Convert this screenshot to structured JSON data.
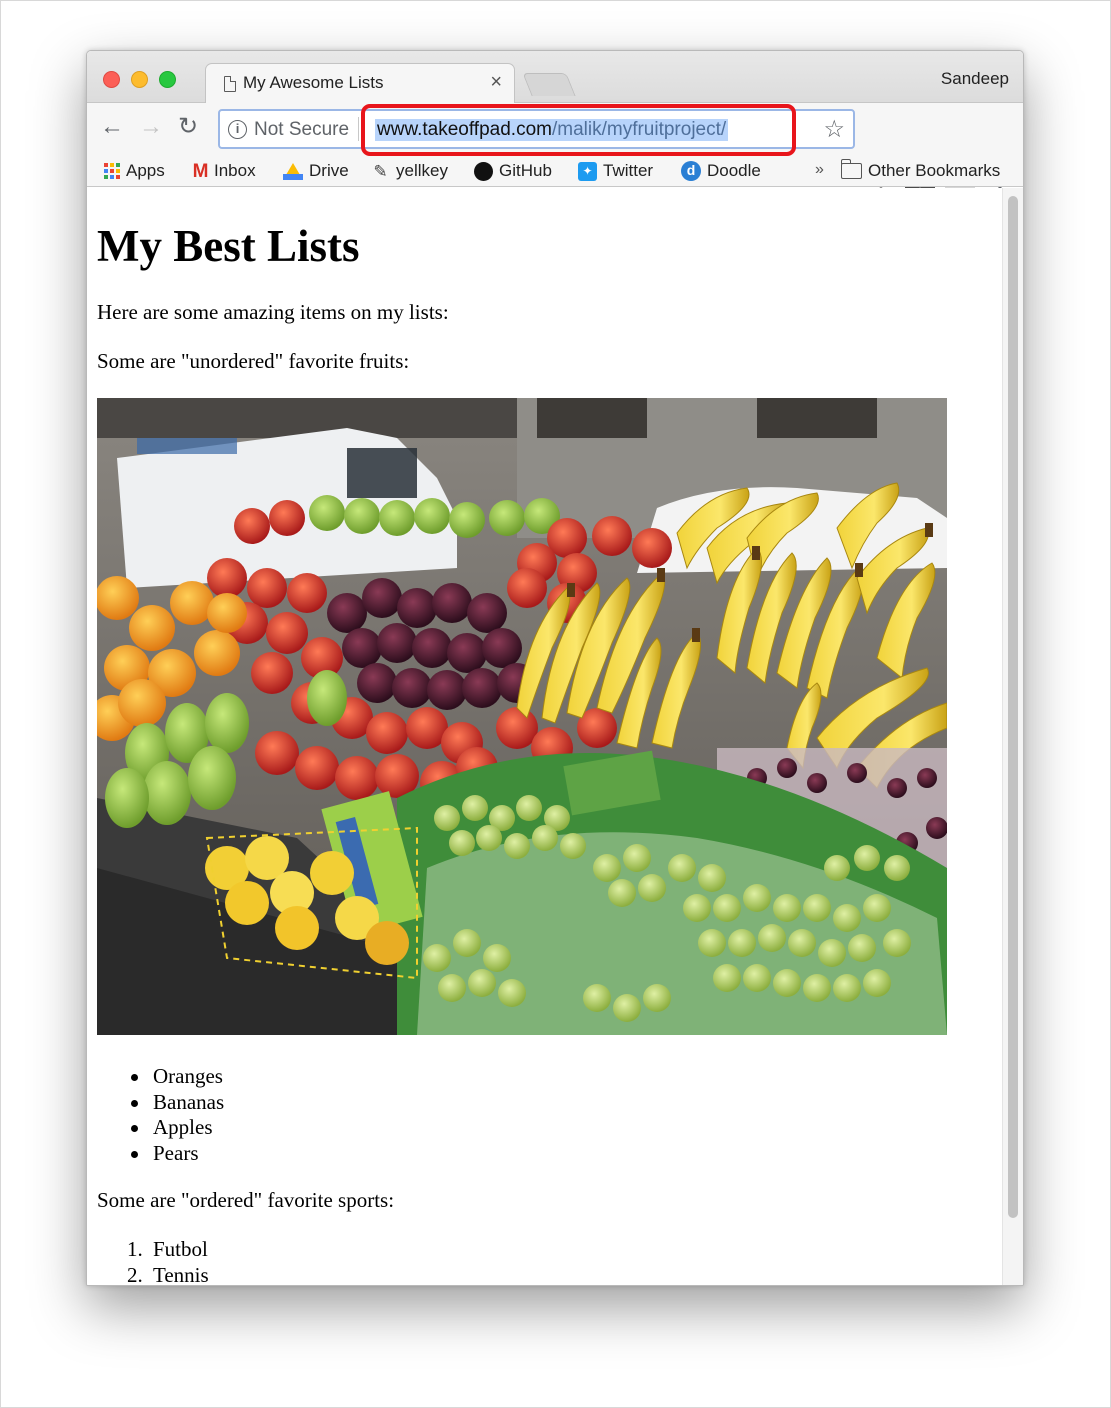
{
  "window": {
    "tab_title": "My Awesome Lists",
    "tab_close": "×",
    "profile_name": "Sandeep"
  },
  "toolbar": {
    "security_label": "Not Secure",
    "url_host": "www.takeoffpad.com",
    "url_path": "/malik/myfruitproject/",
    "back_glyph": "←",
    "forward_glyph": "→",
    "reload_glyph": "↻",
    "star_glyph": "☆",
    "menu_glyph": "⋮",
    "highlight_color": "#e8151b"
  },
  "bookmarks": {
    "items": [
      {
        "label": "Apps",
        "icon": "apps-grid-icon"
      },
      {
        "label": "Inbox",
        "icon": "gmail-icon"
      },
      {
        "label": "Drive",
        "icon": "drive-icon"
      },
      {
        "label": "yellkey",
        "icon": "yellkey-icon"
      },
      {
        "label": "GitHub",
        "icon": "github-icon"
      },
      {
        "label": "Twitter",
        "icon": "twitter-icon"
      },
      {
        "label": "Doodle",
        "icon": "doodle-icon"
      }
    ],
    "more": "»",
    "other_bookmarks": "Other Bookmarks"
  },
  "page": {
    "heading": "My Best Lists",
    "intro": "Here are some amazing items on my lists:",
    "fruits_intro": "Some are \"unordered\" favorite fruits:",
    "fruits": [
      "Oranges",
      "Bananas",
      "Apples",
      "Pears"
    ],
    "sports_intro": "Some are \"ordered\" favorite sports:",
    "sports": [
      "Futbol",
      "Tennis"
    ],
    "photo_icon": "fruit-stand-photo"
  }
}
